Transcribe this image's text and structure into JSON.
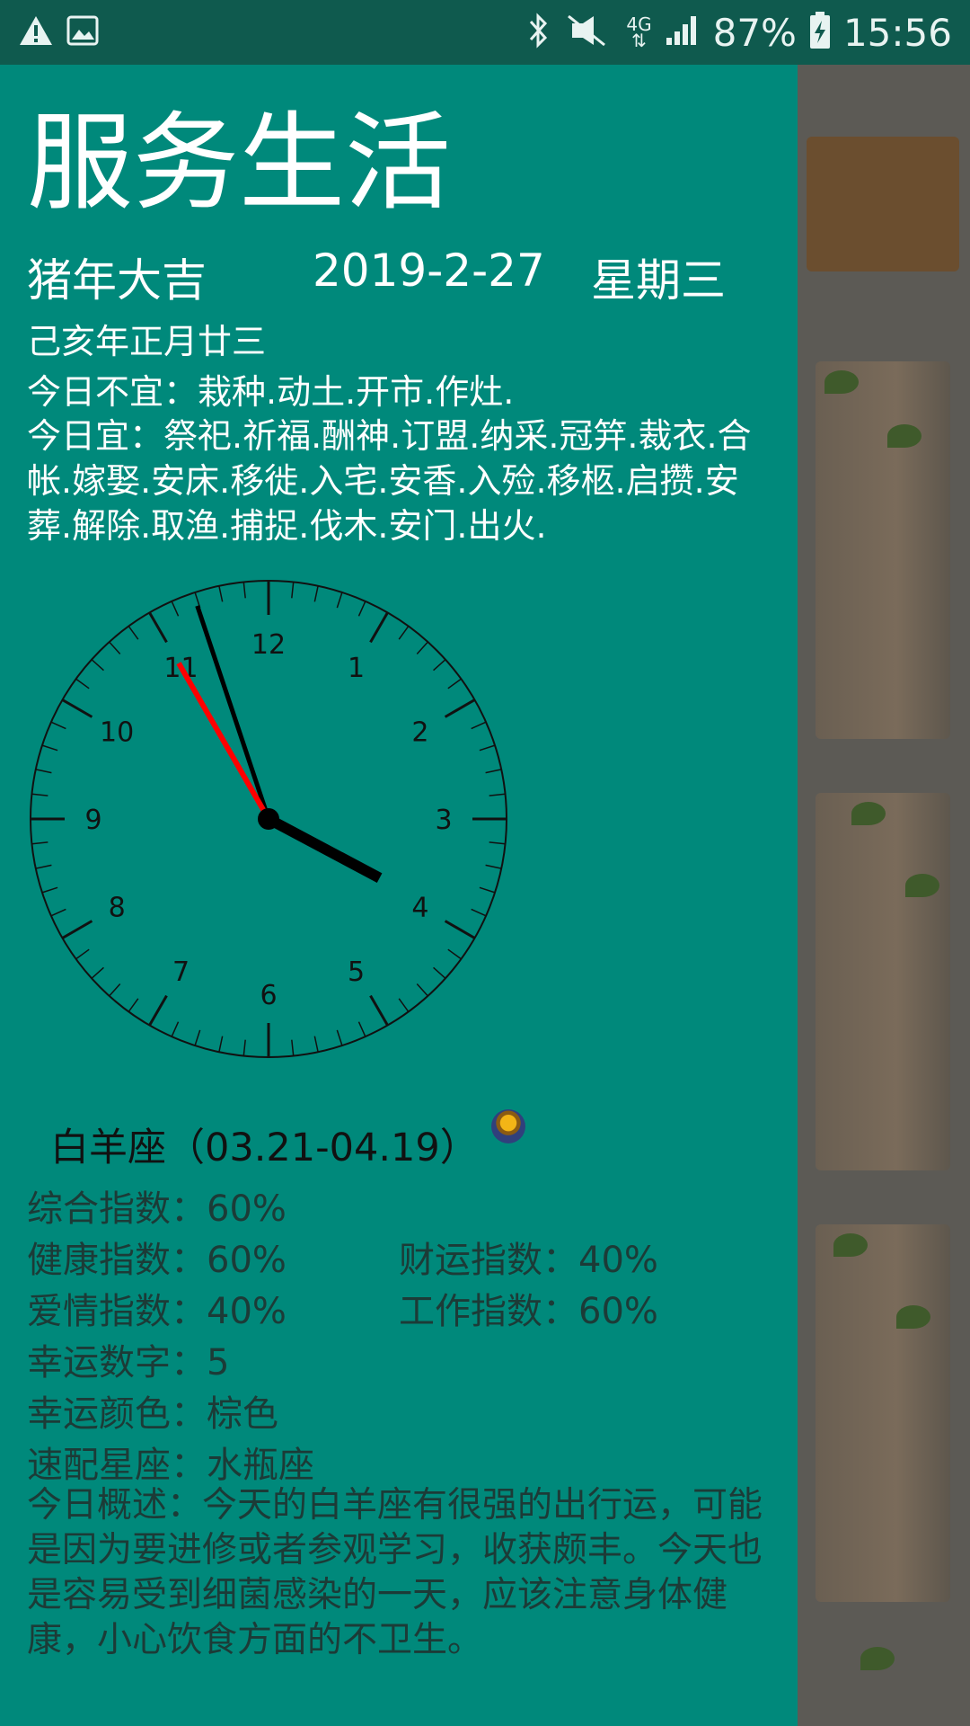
{
  "status_bar": {
    "battery": "87%",
    "time": "15:56",
    "network": "4G",
    "icons": [
      "warning-icon",
      "image-icon",
      "bluetooth-icon",
      "mute-icon",
      "signal-icon",
      "battery-charging-icon"
    ]
  },
  "drawer": {
    "title": "服务生活",
    "greeting": "猪年大吉",
    "date": "2019-2-27",
    "weekday": "星期三",
    "lunar": "己亥年正月廿三",
    "avoid": "今日不宜：栽种.动土.开市.作灶.",
    "suitable": "今日宜：祭祀.祈福.酬神.订盟.纳采.冠笄.裁衣.合帐.嫁娶.安床.移徙.入宅.安香.入殓.移柩.启攒.安葬.解除.取渔.捕捉.伐木.安门.出火."
  },
  "clock": {
    "numbers": [
      "12",
      "1",
      "2",
      "3",
      "4",
      "5",
      "6",
      "7",
      "8",
      "9",
      "10",
      "11"
    ],
    "hour": 3,
    "minute": 56,
    "second": 55
  },
  "horoscope": {
    "sign": "白羊座（03.21-04.19）",
    "overall": "综合指数：60%",
    "health": "健康指数：60%",
    "wealth": "财运指数：40%",
    "love": "爱情指数：40%",
    "work": "工作指数：60%",
    "lucky_number": "幸运数字：5",
    "lucky_color": "幸运颜色：棕色",
    "match": "速配星座：水瓶座",
    "summary": "今日概述：今天的白羊座有很强的出行运，可能是因为要进修或者参观学习，收获颇丰。今天也是容易受到细菌感染的一天，应该注意身体健康，小心饮食方面的不卫生。"
  },
  "colors": {
    "drawer_bg": "#00897b",
    "status_bar_bg": "#0f5a4e",
    "second_hand": "#ff0000",
    "stat_text": "#1c3b37"
  }
}
